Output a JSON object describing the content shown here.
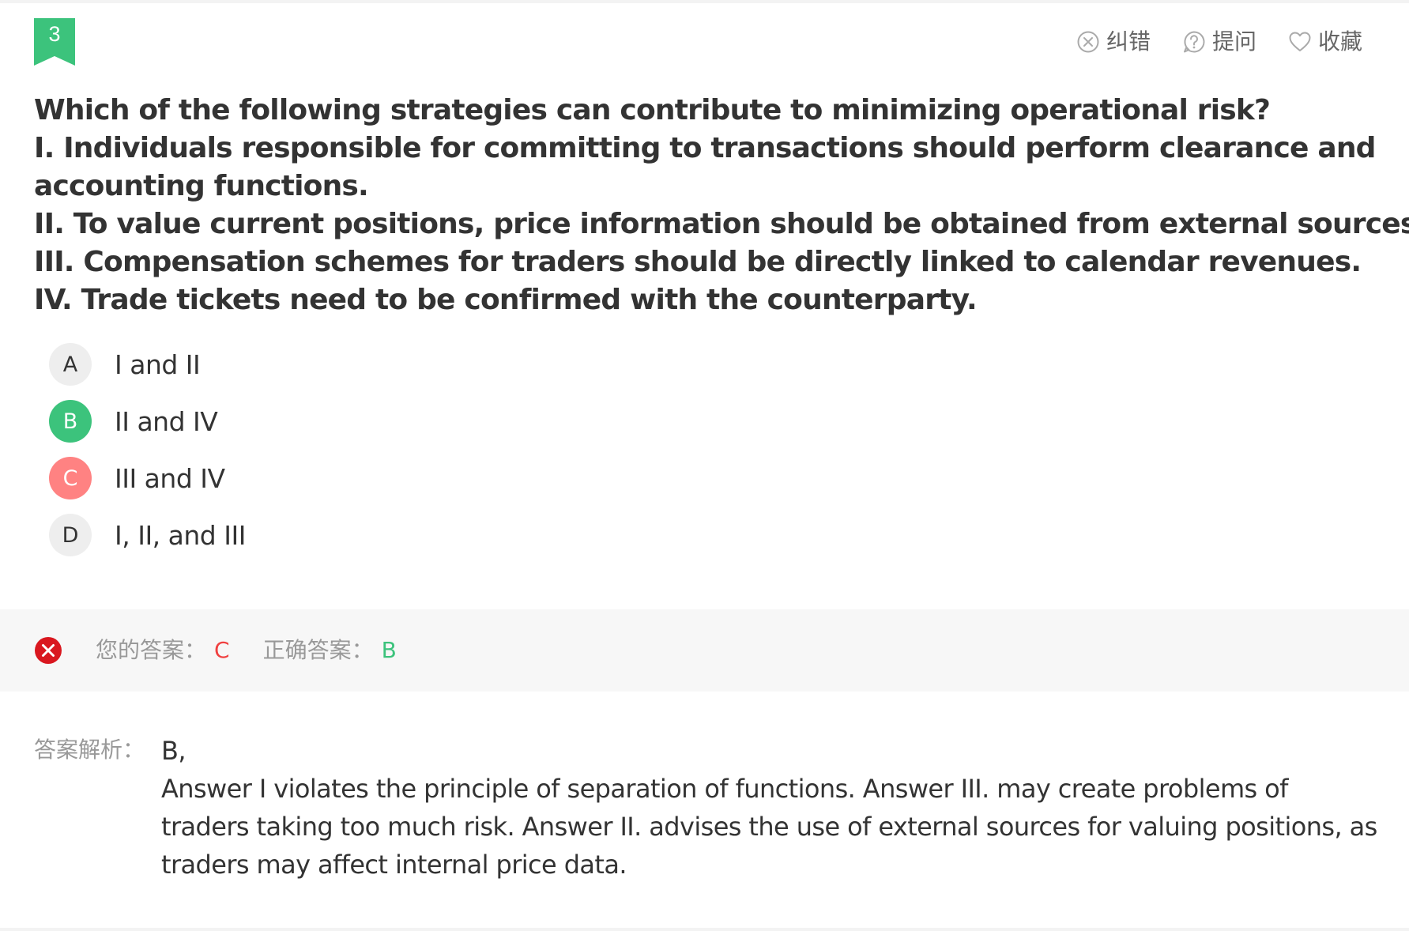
{
  "question": {
    "number": "3",
    "lines": [
      "Which of the following strategies can contribute to minimizing operational risk?",
      "I. Individuals responsible for committing to transactions should perform clearance and",
      "accounting functions.",
      "II. To value current positions, price information should be obtained from external sources.",
      "III. Compensation schemes for traders should be directly linked to calendar revenues.",
      "IV. Trade tickets need to be confirmed with the counterparty."
    ]
  },
  "toolbar": {
    "report_label": "纠错",
    "ask_label": "提问",
    "favorite_label": "收藏"
  },
  "options": [
    {
      "letter": "A",
      "text": "I and II",
      "state": "normal"
    },
    {
      "letter": "B",
      "text": "II and IV",
      "state": "correct"
    },
    {
      "letter": "C",
      "text": "III and IV",
      "state": "wrong"
    },
    {
      "letter": "D",
      "text": "I, II, and III",
      "state": "normal"
    }
  ],
  "result": {
    "your_answer_label": "您的答案：",
    "your_answer": "C",
    "correct_answer_label": "正确答案：",
    "correct_answer": "B"
  },
  "analysis": {
    "label": "答案解析：",
    "lines": [
      "B,",
      "Answer I violates the principle of separation of functions. Answer III. may create problems of",
      "traders taking too much risk. Answer II. advises the use of external sources for valuing positions, as",
      "traders may affect internal price data."
    ]
  },
  "colors": {
    "accent_green": "#3cc37c",
    "wrong_red": "#ff8282",
    "error_icon_red": "#d9171f",
    "text_gray": "#999999"
  }
}
